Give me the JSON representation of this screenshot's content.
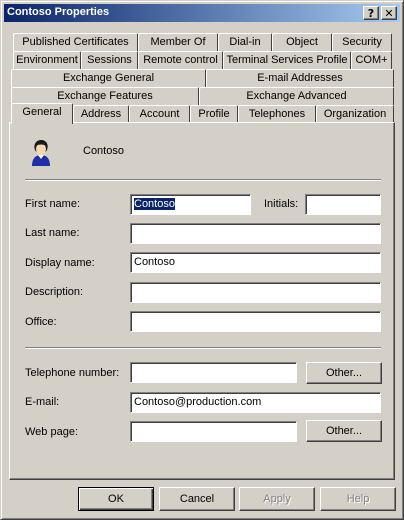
{
  "window": {
    "title": "Contoso Properties",
    "help_label": "?",
    "close_label": "✕"
  },
  "tabs": {
    "row1": [
      "Published Certificates",
      "Member Of",
      "Dial-in",
      "Object",
      "Security"
    ],
    "row2": [
      "Environment",
      "Sessions",
      "Remote control",
      "Terminal Services Profile",
      "COM+"
    ],
    "row3": [
      "Exchange General",
      "E-mail Addresses"
    ],
    "row4": [
      "Exchange Features",
      "Exchange Advanced"
    ],
    "row5": [
      "General",
      "Address",
      "Account",
      "Profile",
      "Telephones",
      "Organization"
    ],
    "active": "General"
  },
  "general": {
    "object_name": "Contoso",
    "avatar_icon": "user-icon",
    "first_name": {
      "label": "First name:",
      "value": "Contoso"
    },
    "initials": {
      "label": "Initials:",
      "value": ""
    },
    "last_name": {
      "label": "Last name:",
      "value": ""
    },
    "display_name": {
      "label": "Display name:",
      "value": "Contoso"
    },
    "description": {
      "label": "Description:",
      "value": ""
    },
    "office": {
      "label": "Office:",
      "value": ""
    },
    "telephone": {
      "label": "Telephone number:",
      "value": ""
    },
    "email": {
      "label": "E-mail:",
      "value": "Contoso@production.com"
    },
    "web_page": {
      "label": "Web page:",
      "value": ""
    },
    "other_label": "Other..."
  },
  "footer": {
    "ok": "OK",
    "cancel": "Cancel",
    "apply": "Apply",
    "help": "Help"
  },
  "colors": {
    "face": "#d4d0c8",
    "title_start": "#0a246a",
    "title_end": "#a6caf0",
    "selection": "#0a246a"
  }
}
